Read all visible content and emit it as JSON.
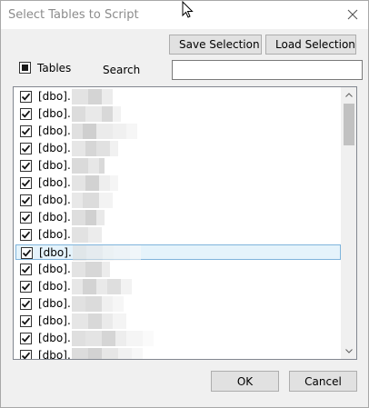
{
  "dialog": {
    "title": "Select Tables to Script"
  },
  "toolbar": {
    "save_label": "Save Selection",
    "load_label": "Load Selection"
  },
  "filter": {
    "tables_label": "Tables",
    "tables_checked": true,
    "search_label": "Search",
    "search_value": "",
    "search_placeholder": ""
  },
  "table_list": {
    "selected_index": 9,
    "items": [
      {
        "label": "[dbo].",
        "checked": true
      },
      {
        "label": "[dbo].",
        "checked": true
      },
      {
        "label": "[dbo].",
        "checked": true
      },
      {
        "label": "[dbo].",
        "checked": true
      },
      {
        "label": "[dbo].",
        "checked": true
      },
      {
        "label": "[dbo].",
        "checked": true
      },
      {
        "label": "[dbo].",
        "checked": true
      },
      {
        "label": "[dbo].",
        "checked": true
      },
      {
        "label": "[dbo].",
        "checked": true
      },
      {
        "label": "[dbo].",
        "checked": true
      },
      {
        "label": "[dbo].",
        "checked": true
      },
      {
        "label": "[dbo].",
        "checked": true
      },
      {
        "label": "[dbo].",
        "checked": true
      },
      {
        "label": "[dbo].",
        "checked": true
      },
      {
        "label": "[dbo].",
        "checked": true
      },
      {
        "label": "[dbo].",
        "checked": true
      }
    ]
  },
  "footer": {
    "ok_label": "OK",
    "cancel_label": "Cancel"
  },
  "icons": {
    "close": "close-icon",
    "checkbox": "checkmark-icon",
    "scroll_up": "chevron-up-icon",
    "scroll_down": "chevron-down-icon",
    "cursor": "mouse-pointer-icon"
  },
  "colors": {
    "selection_fill": "#e5f3fb",
    "selection_border": "#7fb4dc",
    "focus_border": "#4b6ea5",
    "button_fill": "#e1e1e1"
  }
}
